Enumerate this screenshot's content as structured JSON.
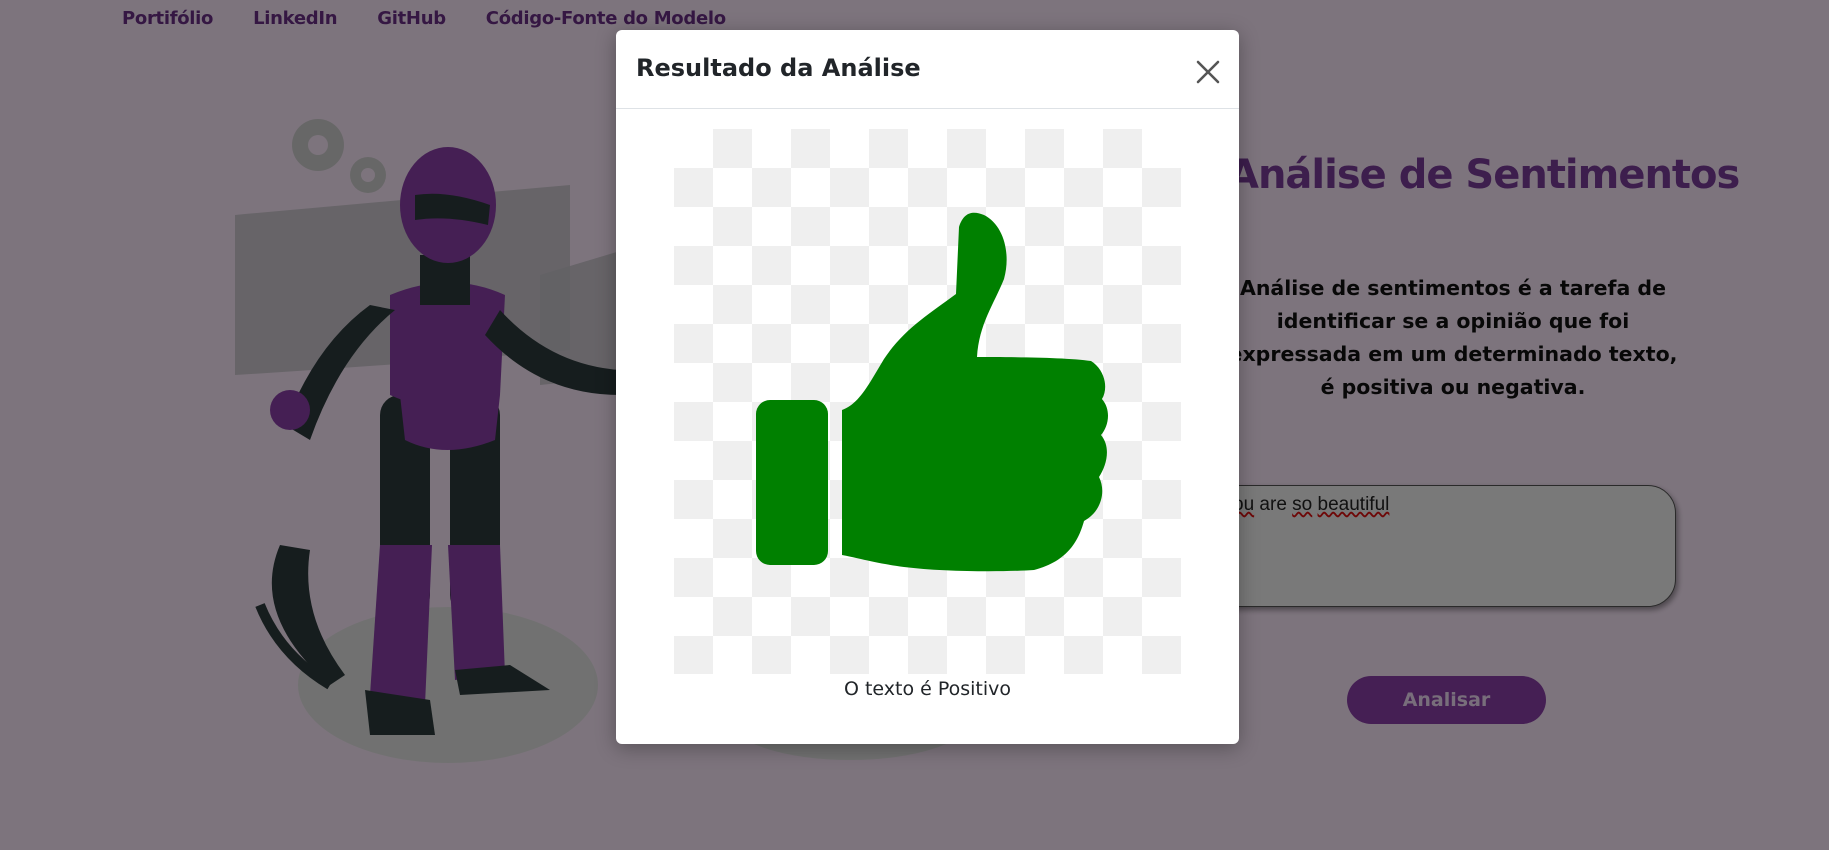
{
  "nav": {
    "links": [
      "Portifólio",
      "LinkedIn",
      "GitHub",
      "Código-Fonte do Modelo"
    ]
  },
  "hero": {
    "title": "Análise de Sentimentos",
    "description": "Análise de sentimentos é a tarefa de identificar se a opinião que foi expressada em um determinado texto, é positiva ou negativa."
  },
  "input": {
    "value_parts": [
      "ou",
      "are",
      "so",
      "beautiful"
    ]
  },
  "analyze_button": {
    "label": "Analisar"
  },
  "modal": {
    "title": "Resultado da Análise",
    "result_text": "O texto é Positivo",
    "image_icon": "thumbs-up-icon",
    "close_icon": "close-icon"
  },
  "colors": {
    "page_background": "#fbe9fb",
    "brand_purple": "#7b3d9a",
    "thumb_green": "#008000",
    "overlay": "rgba(0,0,0,0.5)"
  }
}
